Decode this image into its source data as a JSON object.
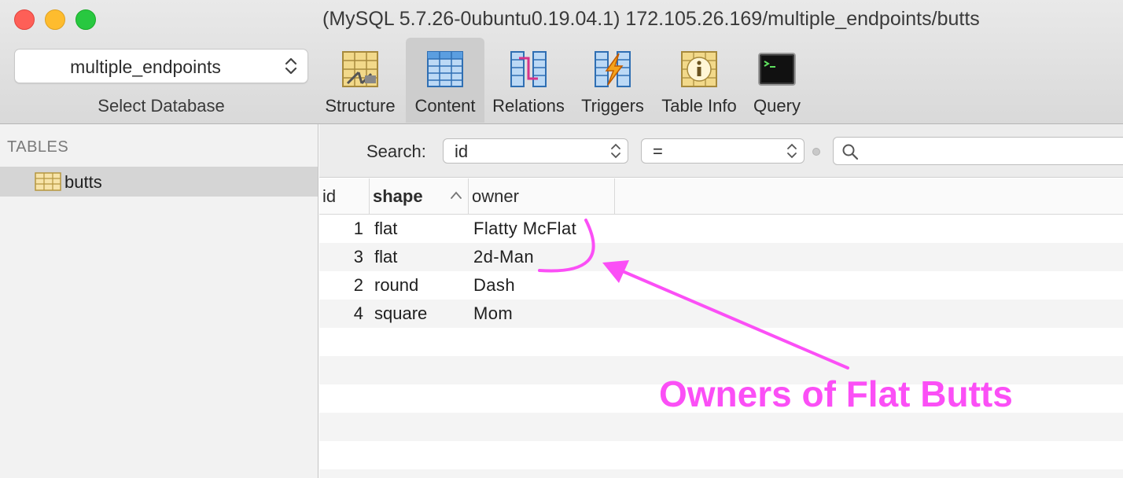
{
  "window": {
    "title": "(MySQL 5.7.26-0ubuntu0.19.04.1) 172.105.26.169/multiple_endpoints/butts"
  },
  "toolbar": {
    "database_select": {
      "value": "multiple_endpoints",
      "label": "Select Database"
    },
    "tools": [
      {
        "label": "Structure",
        "icon": "structure-icon",
        "active": false
      },
      {
        "label": "Content",
        "icon": "content-icon",
        "active": true
      },
      {
        "label": "Relations",
        "icon": "relations-icon",
        "active": false
      },
      {
        "label": "Triggers",
        "icon": "triggers-icon",
        "active": false
      },
      {
        "label": "Table Info",
        "icon": "table-info-icon",
        "active": false
      },
      {
        "label": "Query",
        "icon": "query-icon",
        "active": false
      }
    ]
  },
  "sidebar": {
    "heading": "TABLES",
    "items": [
      {
        "label": "butts",
        "icon": "table-icon",
        "selected": true
      }
    ]
  },
  "search": {
    "label": "Search:",
    "field_value": "id",
    "operator_value": "=",
    "query_value": ""
  },
  "table": {
    "columns": [
      {
        "label": "id",
        "sorted": false
      },
      {
        "label": "shape",
        "sorted": true
      },
      {
        "label": "owner",
        "sorted": false
      }
    ],
    "rows": [
      {
        "id": "1",
        "shape": "flat",
        "owner": "Flatty McFlat"
      },
      {
        "id": "3",
        "shape": "flat",
        "owner": "2d-Man"
      },
      {
        "id": "2",
        "shape": "round",
        "owner": "Dash"
      },
      {
        "id": "4",
        "shape": "square",
        "owner": "Mom"
      }
    ]
  },
  "annotation": {
    "text": "Owners of Flat Butts",
    "color": "#fb4ff6"
  },
  "colors": {
    "close": "#fe5f57",
    "minimize": "#febc2e",
    "maximize": "#28c840",
    "selection": "#d5d5d5"
  }
}
